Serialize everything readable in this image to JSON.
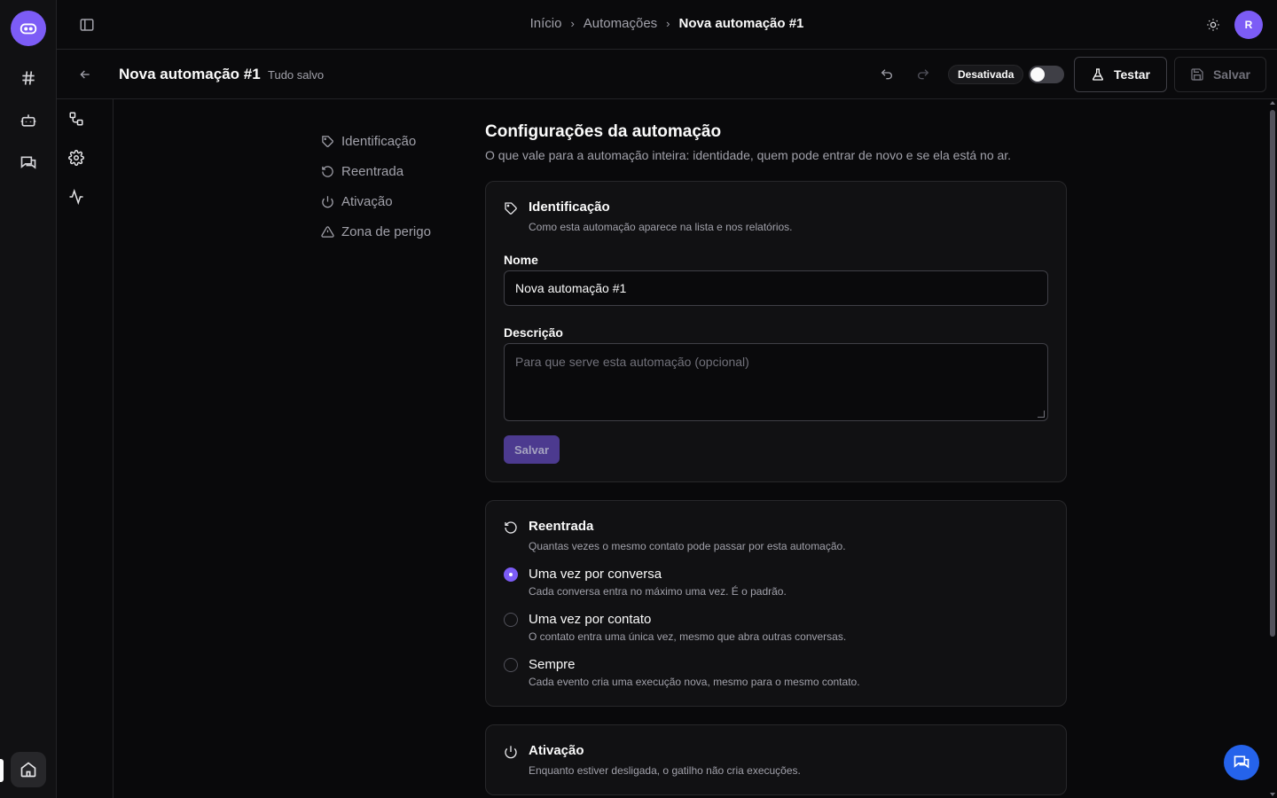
{
  "colors": {
    "accent": "#7c5cf6",
    "background": "#09090b",
    "card": "#111113",
    "border": "#27272a",
    "fab": "#2563eb"
  },
  "rail": {
    "logo_icon": "bot-logo-icon",
    "items": [
      {
        "icon": "hash-icon"
      },
      {
        "icon": "bot-icon"
      },
      {
        "icon": "messages-icon"
      }
    ],
    "home_icon": "home-icon"
  },
  "topbar": {
    "breadcrumb": [
      {
        "label": "Início"
      },
      {
        "label": "Automações"
      },
      {
        "label": "Nova automação #1"
      }
    ],
    "avatar_initial": "R"
  },
  "subheader": {
    "title": "Nova automação #1",
    "save_status": "Tudo salvo",
    "status_label": "Desativada",
    "toggle_on": false,
    "test_label": "Testar",
    "save_label": "Salvar"
  },
  "section_nav": [
    {
      "label": "Identificação",
      "icon": "tag-icon"
    },
    {
      "label": "Reentrada",
      "icon": "rotate-icon"
    },
    {
      "label": "Ativação",
      "icon": "power-icon"
    },
    {
      "label": "Zona de perigo",
      "icon": "warning-icon"
    }
  ],
  "main": {
    "title": "Configurações da automação",
    "description": "O que vale para a automação inteira: identidade, quem pode entrar de novo e se ela está no ar."
  },
  "identification": {
    "title": "Identificação",
    "subtitle": "Como esta automação aparece na lista e nos relatórios.",
    "name_label": "Nome",
    "name_value": "Nova automação #1",
    "description_label": "Descrição",
    "description_placeholder": "Para que serve esta automação (opcional)",
    "save_label": "Salvar"
  },
  "reentry": {
    "title": "Reentrada",
    "subtitle": "Quantas vezes o mesmo contato pode passar por esta automação.",
    "options": [
      {
        "label": "Uma vez por conversa",
        "description": "Cada conversa entra no máximo uma vez. É o padrão.",
        "selected": true
      },
      {
        "label": "Uma vez por contato",
        "description": "O contato entra uma única vez, mesmo que abra outras conversas.",
        "selected": false
      },
      {
        "label": "Sempre",
        "description": "Cada evento cria uma execução nova, mesmo para o mesmo contato.",
        "selected": false
      }
    ]
  },
  "activation": {
    "title": "Ativação",
    "subtitle": "Enquanto estiver desligada, o gatilho não cria execuções."
  }
}
